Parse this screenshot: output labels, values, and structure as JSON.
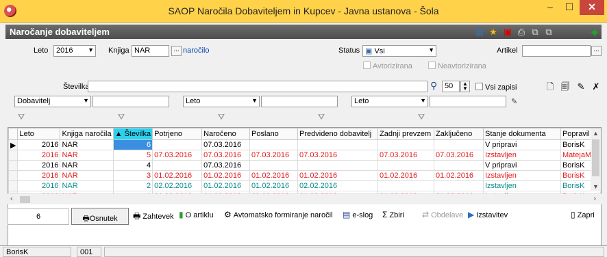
{
  "window": {
    "title": "SAOP  Naročila Dobaviteljem in Kupcev - Javna ustanova - Šola",
    "minimize": "–",
    "maximize": "☐",
    "close": "✕"
  },
  "section": {
    "title": "Naročanje dobaviteljem"
  },
  "filters": {
    "leto_label": "Leto",
    "leto_value": "2016",
    "knjiga_label": "Knjiga",
    "knjiga_value": "NAR",
    "knjiga_desc": "naročilo",
    "status_label": "Status",
    "status_value": "Vsi",
    "artikel_label": "Artikel",
    "artikel_value": "",
    "avtorizirana": "Avtorizirana",
    "neavtorizirana": "Neavtorizirana",
    "stevilka_label": "Številka",
    "stevilka_value": "",
    "count_value": "50",
    "vsi_zapisi": "Vsi zapisi",
    "filter1_select": "Dobavitelj",
    "filter2_select": "Leto",
    "filter3_select": "Leto"
  },
  "table": {
    "columns": [
      "Leto",
      "Knjiga naročila",
      "Številka",
      "Potrjeno",
      "Naročeno",
      "Poslano",
      "Predvideno dobavitelj",
      "Zadnji prevzem",
      "Zaključeno",
      "Stanje dokumenta",
      "Popravil"
    ],
    "rows": [
      {
        "color": "black",
        "cells": [
          "2016",
          "NAR",
          "6",
          "",
          "07.03.2016",
          "",
          "",
          "",
          "",
          "V pripravi",
          "BorisK"
        ]
      },
      {
        "color": "red",
        "cells": [
          "2016",
          "NAR",
          "5",
          "07.03.2016",
          "07.03.2016",
          "07.03.2016",
          "07.03.2016",
          "07.03.2016",
          "07.03.2016",
          "Izstavljen",
          "MatejaM"
        ]
      },
      {
        "color": "black",
        "cells": [
          "2016",
          "NAR",
          "4",
          "",
          "07.03.2016",
          "",
          "",
          "",
          "",
          "V pripravi",
          "BorisK"
        ]
      },
      {
        "color": "red",
        "cells": [
          "2016",
          "NAR",
          "3",
          "01.02.2016",
          "01.02.2016",
          "01.02.2016",
          "01.02.2016",
          "01.02.2016",
          "01.02.2016",
          "Izstavljen",
          "BorisK"
        ]
      },
      {
        "color": "teal",
        "cells": [
          "2016",
          "NAR",
          "2",
          "02.02.2016",
          "01.02.2016",
          "01.02.2016",
          "02.02.2016",
          "",
          "",
          "Izstavljen",
          "BorisK"
        ]
      },
      {
        "color": "red",
        "cells": [
          "2016",
          "NAR",
          "1",
          "01.02.2016",
          "01.02.2016",
          "29.02.2016",
          "01.02.2016",
          "01.02.2016",
          "01.02.2016",
          "Izstavljen",
          "BorisK"
        ]
      }
    ]
  },
  "toolbar": {
    "count": "6",
    "osnutek": "Osnutek",
    "zahtevek": "Zahtevek",
    "o_artiklu": "O artiklu",
    "avtomatsko": "Avtomatsko formiranje naročil",
    "eslog": "e-slog",
    "zbiri": "Zbiri",
    "obdelave": "Obdelave",
    "izstavitev": "Izstavitev",
    "zapri": "Zapri"
  },
  "status": {
    "user": "BorisK",
    "code": "001"
  },
  "colors": {
    "titlebar": "#ffd24a",
    "red": "#e21c1c",
    "teal": "#0a8b8b",
    "sorted_header": "#29d3f0"
  }
}
